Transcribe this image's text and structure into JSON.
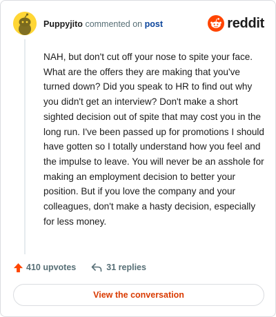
{
  "header": {
    "author": "Puppyjito",
    "commented_text": "commented on",
    "post_link": "post",
    "brand": "reddit",
    "avatar_icon": "snoo-avatar-icon",
    "brand_icon": "reddit-logo-icon"
  },
  "comment": {
    "body": "NAH, but don't cut off your nose to spite your face. What are the offers they are making that you've turned down? Did you speak to HR to find out why you didn't get an interview? Don't make a short sighted decision out of spite that may cost you in the long run. I've been passed up for promotions I should have gotten so I totally understand how you feel and the impulse to leave. You will never be an asshole for making an employment decision to better your position. But if you love the company and your colleagues, don't make a hasty decision, especially for less money."
  },
  "actions": {
    "upvotes": "410 upvotes",
    "replies": "31 replies",
    "upvote_icon": "upvote-arrow-icon",
    "reply_icon": "reply-arrow-icon"
  },
  "cta": {
    "label": "View the conversation"
  },
  "colors": {
    "brand_orange": "#ff4500",
    "cta_text": "#d93a00",
    "link_blue": "#0a449b",
    "meta_gray": "#576f76",
    "avatar_yellow": "#ffd635"
  }
}
